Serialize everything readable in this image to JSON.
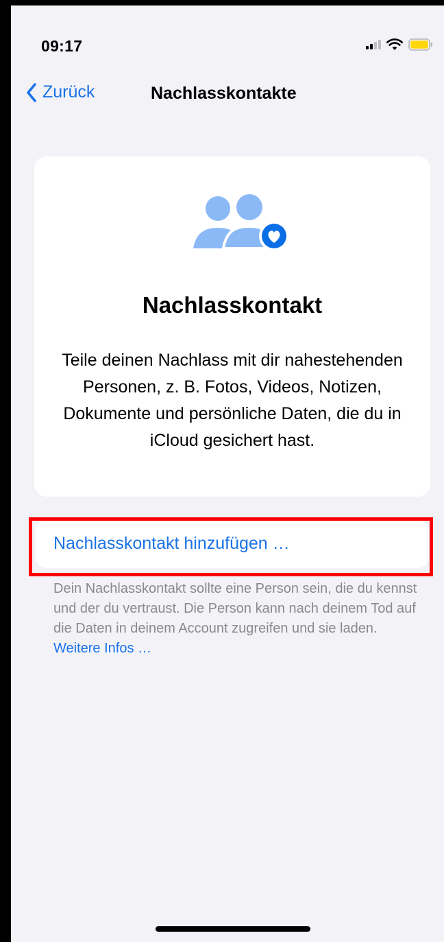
{
  "status_bar": {
    "time": "09:17",
    "icons": [
      "signal-icon",
      "wifi-icon",
      "battery-icon"
    ],
    "battery_color": "#ffd60a"
  },
  "nav": {
    "back_label": "Zurück",
    "title": "Nachlasskontakte"
  },
  "card": {
    "icon": "people-heart-icon",
    "title": "Nachlasskontakt",
    "description": "Teile deinen Nachlass mit dir nahestehenden Personen, z. B. Fotos, Videos, Notizen, Dokumente und persönliche Daten, die du in iCloud gesichert hast."
  },
  "action": {
    "label": "Nachlasskontakt hinzufügen …",
    "highlight_color": "#ff0000"
  },
  "footer": {
    "text": "Dein Nachlasskontakt sollte eine Person sein, die du kennst und der du vertraust. Die Person kann nach deinem Tod auf die Daten in deinem Account zugreifen und sie laden.",
    "link": "Weitere Infos …"
  },
  "colors": {
    "accent": "#1a73e8",
    "background": "#f2f2f7",
    "icon_light": "#8ab9f5",
    "icon_dark": "#0a6ee6"
  }
}
